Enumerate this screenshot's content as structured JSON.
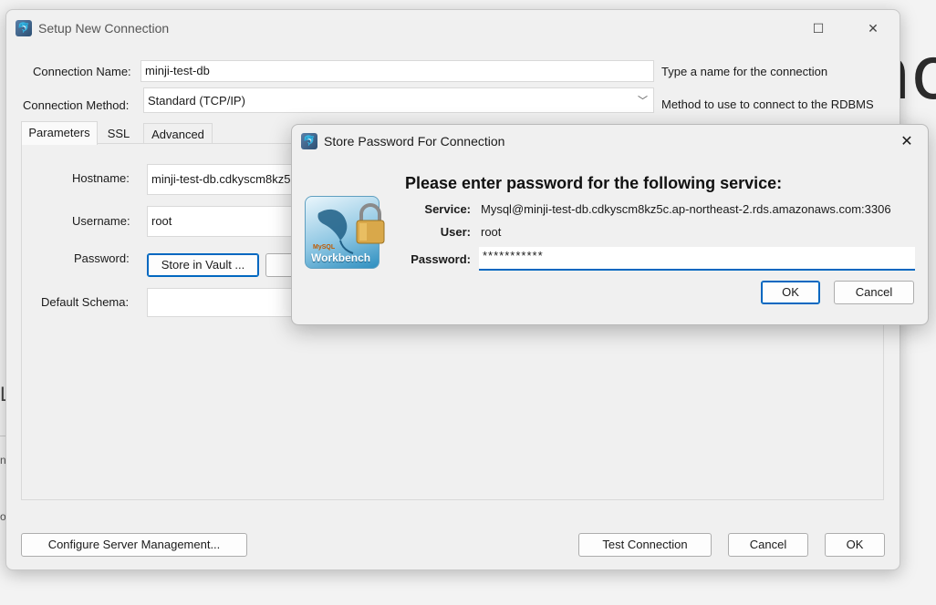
{
  "background": {
    "fragment_1": "no",
    "fragment_2": "L",
    "fragment_3": "n",
    "fragment_4": "o"
  },
  "window": {
    "title": "Setup New Connection",
    "icon": "mysql-workbench-icon",
    "controls": {
      "minimize": "—",
      "maximize": "☐",
      "close": "✕"
    }
  },
  "form": {
    "connection_name_label": "Connection Name:",
    "connection_name_value": "minji-test-db",
    "connection_name_hint": "Type a name for the connection",
    "connection_method_label": "Connection Method:",
    "connection_method_value": "Standard (TCP/IP)",
    "connection_method_hint": "Method to use to connect to the RDBMS"
  },
  "tabs": [
    {
      "label": "Parameters",
      "active": true
    },
    {
      "label": "SSL",
      "active": false
    },
    {
      "label": "Advanced",
      "active": false
    }
  ],
  "parameters": {
    "hostname_label": "Hostname:",
    "hostname_value": "minji-test-db.cdkyscm8kz5",
    "username_label": "Username:",
    "username_value": "root",
    "password_label": "Password:",
    "store_in_vault_label": "Store in Vault ...",
    "default_schema_label": "Default Schema:",
    "default_schema_value": ""
  },
  "footer": {
    "configure_server_label": "Configure Server Management...",
    "test_connection_label": "Test Connection",
    "cancel_label": "Cancel",
    "ok_label": "OK"
  },
  "modal": {
    "title": "Store Password For Connection",
    "heading": "Please enter password for the following service:",
    "service_label": "Service:",
    "service_value": "Mysql@minji-test-db.cdkyscm8kz5c.ap-northeast-2.rds.amazonaws.com:3306",
    "user_label": "User:",
    "user_value": "root",
    "password_label": "Password:",
    "password_value": "***********",
    "ok_label": "OK",
    "cancel_label": "Cancel",
    "close": "✕",
    "logo_text_1": "MySQL",
    "logo_text_2": "Workbench"
  },
  "colors": {
    "accent": "#0067c0",
    "window_bg": "#f0f0f0"
  }
}
